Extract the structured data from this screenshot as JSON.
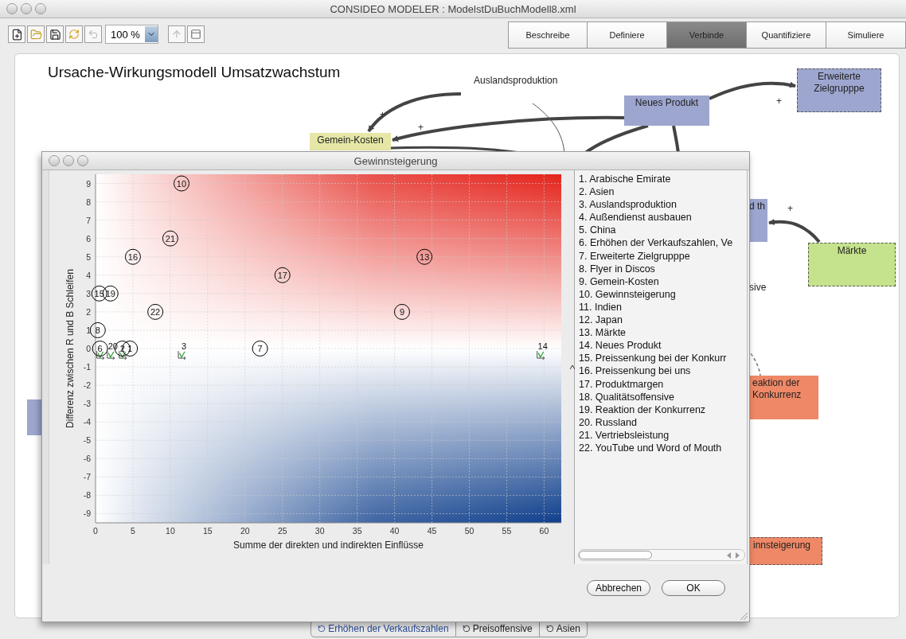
{
  "window": {
    "title": "CONSIDEO MODELER : ModelstDuBuchModell8.xml"
  },
  "toolbar": {
    "zoom": "100 %"
  },
  "phases": [
    {
      "label": "Beschreibe",
      "selected": false
    },
    {
      "label": "Definiere",
      "selected": false
    },
    {
      "label": "Verbinde",
      "selected": true
    },
    {
      "label": "Quantifiziere",
      "selected": false
    },
    {
      "label": "Simuliere",
      "selected": false
    }
  ],
  "canvas": {
    "title": "Ursache-Wirkungsmodell Umsatzwachstum",
    "nodes": [
      {
        "kind": "text",
        "label": "Auslandsproduktion"
      },
      {
        "kind": "box",
        "label": "Gemein-Kosten",
        "color": "#e6e6a6"
      },
      {
        "kind": "box",
        "label": "Neues Produkt",
        "color": "#9da6cf"
      },
      {
        "kind": "dashed",
        "label": "Erweiterte Zielgrupppe",
        "color": "#9da6cf"
      },
      {
        "kind": "box",
        "label": "d th",
        "color": "#9da6cf"
      },
      {
        "kind": "dashed",
        "label": "Märkte",
        "color": "#c5e28c"
      },
      {
        "kind": "text",
        "label": "sive"
      },
      {
        "kind": "box",
        "label": "eaktion der Konkurrenz",
        "color": "#ee8866"
      },
      {
        "kind": "dashed",
        "label": "innsteigerung",
        "color": "#ee8866"
      },
      {
        "kind": "box",
        "color": "#9da6cf"
      }
    ],
    "signs": [
      "+",
      "+",
      "+",
      "+"
    ]
  },
  "dialog": {
    "title": "Gewinnsteigerung",
    "chart_data": {
      "type": "scatter",
      "xlabel": "Summe der direkten und indirekten Einflüsse",
      "ylabel": "Differenz zwischen R und B Schleifen",
      "x": [
        11.5,
        10,
        5,
        44,
        25,
        0.5,
        2,
        8,
        41,
        0.3,
        22,
        3.6,
        4.6,
        0.6,
        2,
        11.5,
        59.5
      ],
      "series": [
        {
          "color": "#000000",
          "values": [
            9,
            6,
            5,
            5,
            4,
            3,
            3,
            2,
            2,
            1,
            0,
            0,
            0,
            0,
            null,
            null,
            null
          ]
        },
        {
          "color": "#2e9e2e",
          "values": [
            null,
            null,
            null,
            null,
            null,
            null,
            null,
            null,
            null,
            null,
            null,
            -0.35,
            null,
            -0.35,
            -0.35,
            -0.35,
            -0.35
          ]
        }
      ],
      "grid": true,
      "xlim": [
        0,
        62.3
      ],
      "ylim": [
        -9.5,
        9.5
      ],
      "xticks": [
        0,
        5,
        10,
        15,
        20,
        25,
        30,
        35,
        40,
        45,
        50,
        55,
        60
      ],
      "yticks": [
        -9,
        -8,
        -7,
        -6,
        -5,
        -4,
        -3,
        -2,
        -1,
        0,
        1,
        2,
        3,
        4,
        5,
        6,
        7,
        8,
        9
      ],
      "annotations": [
        {
          "x": 11.5,
          "y": 9,
          "text": "10"
        },
        {
          "x": 10,
          "y": 6,
          "text": "21"
        },
        {
          "x": 5,
          "y": 5,
          "text": "16"
        },
        {
          "x": 44,
          "y": 5,
          "text": "13"
        },
        {
          "x": 25,
          "y": 4,
          "text": "17"
        },
        {
          "x": 0.5,
          "y": 3,
          "text": "15"
        },
        {
          "x": 2,
          "y": 3,
          "text": "19"
        },
        {
          "x": 8,
          "y": 2,
          "text": "22"
        },
        {
          "x": 41,
          "y": 2,
          "text": "9"
        },
        {
          "x": 0.3,
          "y": 1,
          "text": "8"
        },
        {
          "x": 22,
          "y": 0,
          "text": "7"
        },
        {
          "x": 3.6,
          "y": 0,
          "text": "2"
        },
        {
          "x": 4.6,
          "y": 0,
          "text": "1"
        },
        {
          "x": 0.6,
          "y": 0,
          "text": "6"
        },
        {
          "x": 2,
          "y": -0.35,
          "text": "20"
        },
        {
          "x": 11.5,
          "y": -0.35,
          "text": "3"
        },
        {
          "x": 59.5,
          "y": -0.35,
          "text": "14"
        }
      ]
    },
    "legend": [
      "1. Arabische Emirate",
      "2. Asien",
      "3. Auslandsproduktion",
      "4. Außendienst ausbauen",
      "5. China",
      "6. Erhöhen der Verkaufszahlen, Ve",
      "7. Erweiterte Zielgrupppe",
      "8. Flyer in Discos",
      "9. Gemein-Kosten",
      "10. Gewinnsteigerung",
      "11. Indien",
      "12. Japan",
      "13. Märkte",
      "14. Neues Produkt",
      "15. Preissenkung bei der Konkurr",
      "16. Preissenkung bei uns",
      "17. Produktmargen",
      "18. Qualitätsoffensive",
      "19. Reaktion der Konkurrenz",
      "20. Russland",
      "21. Vertriebsleistung",
      "22. YouTube und Word of Mouth"
    ],
    "buttons": [
      "Abbrechen",
      "OK"
    ]
  },
  "bottom_tabs": [
    {
      "label": "Erhöhen der Verkaufszahlen",
      "selected": true
    },
    {
      "label": "Preisoffensive",
      "selected": false
    },
    {
      "label": "Asien",
      "selected": false
    }
  ]
}
